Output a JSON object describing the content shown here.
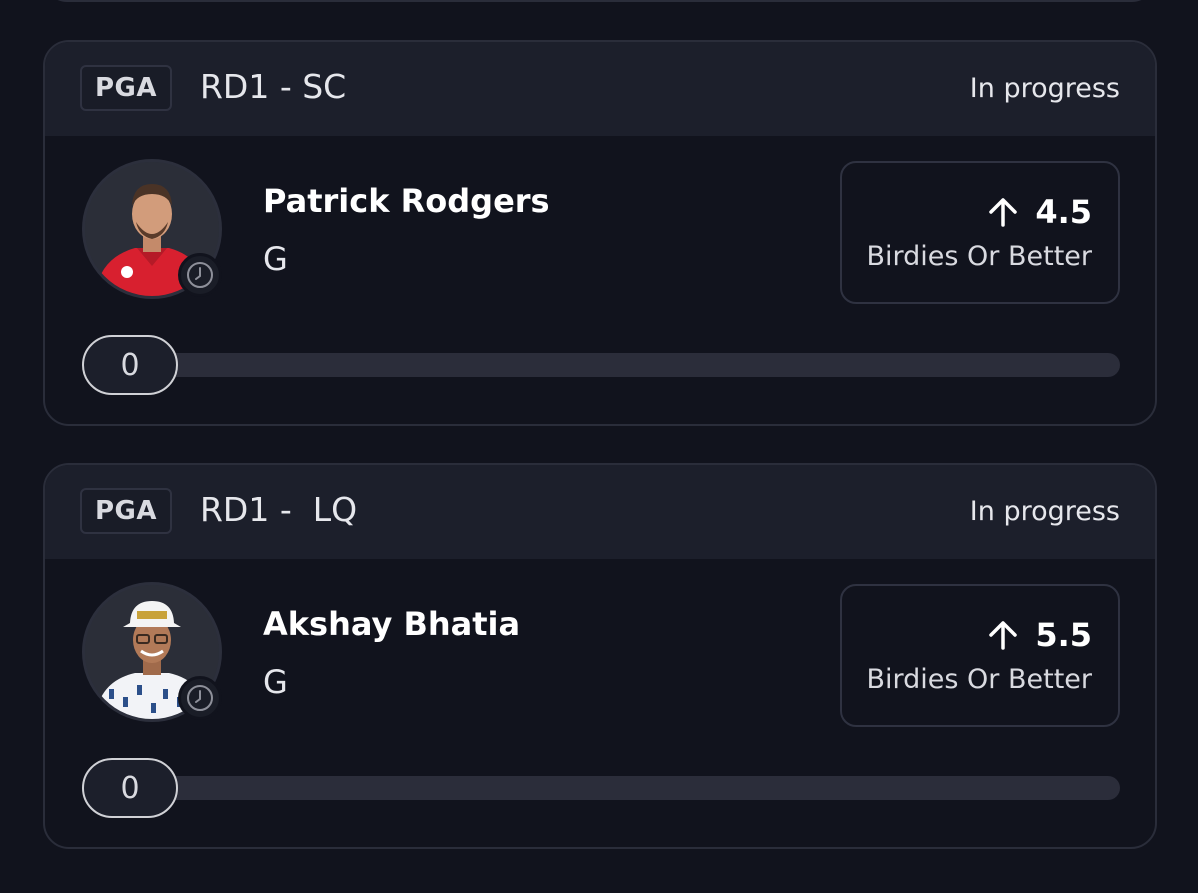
{
  "cards": [
    {
      "league": "PGA",
      "round": "RD1 - SC",
      "status": "In progress",
      "player": {
        "name": "Patrick Rodgers",
        "position": "G",
        "shirt_color": "#d8202f"
      },
      "line": {
        "direction_icon": "arrow-up-icon",
        "value": "4.5",
        "stat": "Birdies Or Better"
      },
      "progress": {
        "current": "0"
      }
    },
    {
      "league": "PGA",
      "round": "RD1 -  LQ",
      "status": "In progress",
      "player": {
        "name": "Akshay Bhatia",
        "position": "G",
        "shirt_color": "#f2f3f7"
      },
      "line": {
        "direction_icon": "arrow-up-icon",
        "value": "5.5",
        "stat": "Birdies Or Better"
      },
      "progress": {
        "current": "0"
      }
    }
  ],
  "colors": {
    "background": "#11131d",
    "card_header": "#1c1f2b",
    "border": "#2a2d3a",
    "track": "#2b2d3a"
  }
}
